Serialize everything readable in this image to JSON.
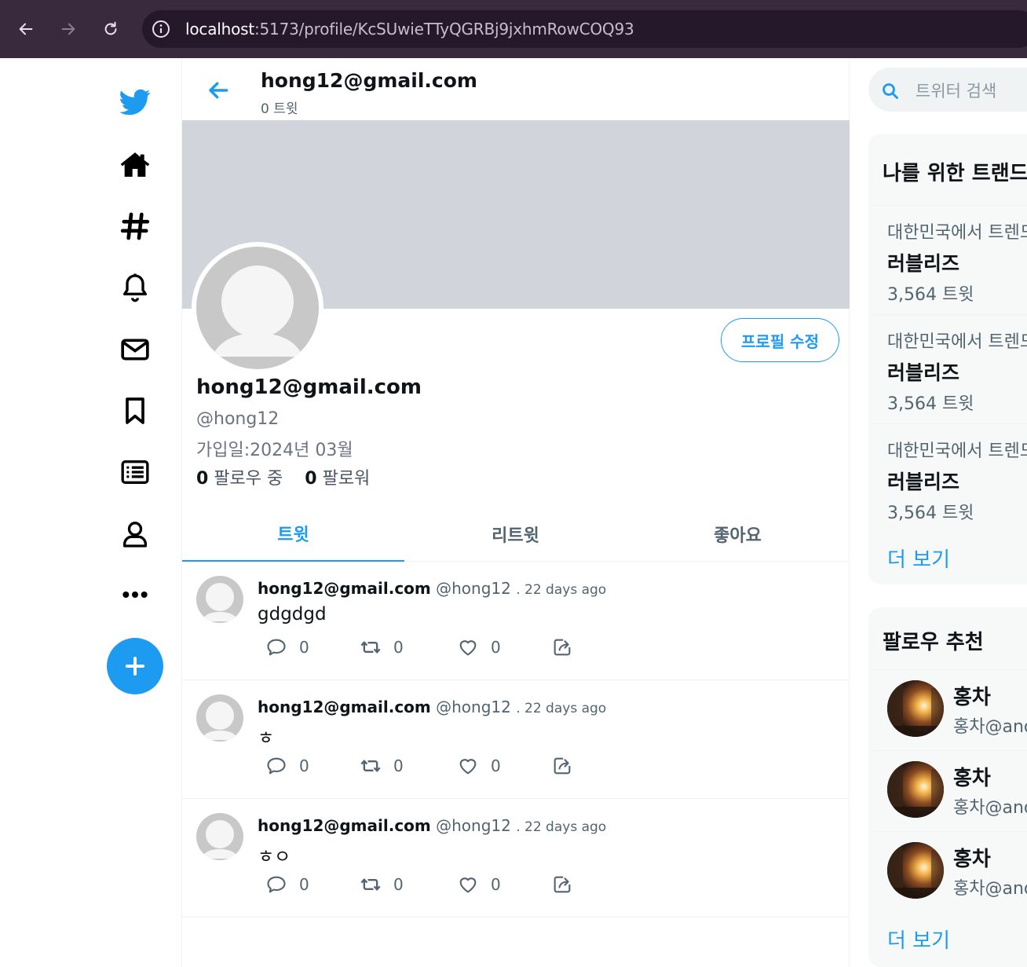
{
  "browser": {
    "url_host": "localhost",
    "url_path": ":5173/profile/KcSUwieTTyQGRBj9jxhmRowCOQ93"
  },
  "nav": {
    "icons": [
      "twitter-logo-icon",
      "home-icon",
      "hashtag-icon",
      "bell-icon",
      "mail-icon",
      "bookmark-icon",
      "list-icon",
      "user-icon",
      "more-icon"
    ]
  },
  "colors": {
    "accent": "#1d9bf0",
    "banner": "#d1d5db",
    "avatar": "#c8c8c8"
  },
  "header": {
    "name": "hong12@gmail.com",
    "tweet_count": "0 트윗"
  },
  "profile": {
    "edit_button": "프로필 수정",
    "name": "hong12@gmail.com",
    "handle": "@hong12",
    "joined": "가입일:2024년 03월",
    "following_count": "0",
    "following_label": "팔로우 중",
    "followers_count": "0",
    "followers_label": "팔로워"
  },
  "tabs": [
    "트윗",
    "리트윗",
    "좋아요"
  ],
  "tweets": [
    {
      "name": "hong12@gmail.com",
      "handle": "@hong12",
      "date": ". 22 days ago",
      "text": "gdgdgd",
      "replies": "0",
      "retweets": "0",
      "likes": "0"
    },
    {
      "name": "hong12@gmail.com",
      "handle": "@hong12",
      "date": ". 22 days ago",
      "text": "ㅎ",
      "replies": "0",
      "retweets": "0",
      "likes": "0"
    },
    {
      "name": "hong12@gmail.com",
      "handle": "@hong12",
      "date": ". 22 days ago",
      "text": "ㅎㅇ",
      "replies": "0",
      "retweets": "0",
      "likes": "0"
    }
  ],
  "sidebar": {
    "search_placeholder": "트위터 검색",
    "trends_title": "나를 위한 트랜드",
    "trends": [
      {
        "context": "대한민국에서 트렌드 중",
        "topic": "러블리즈",
        "count": "3,564 트윗"
      },
      {
        "context": "대한민국에서 트렌드 중",
        "topic": "러블리즈",
        "count": "3,564 트윗"
      },
      {
        "context": "대한민국에서 트렌드 중",
        "topic": "러블리즈",
        "count": "3,564 트윗"
      }
    ],
    "trends_more": "더 보기",
    "who_title": "팔로우 추천",
    "who": [
      {
        "name": "홍차",
        "handle": "홍차@anonymous"
      },
      {
        "name": "홍차",
        "handle": "홍차@anonymous"
      },
      {
        "name": "홍차",
        "handle": "홍차@anonymous"
      }
    ],
    "who_more": "더 보기"
  }
}
